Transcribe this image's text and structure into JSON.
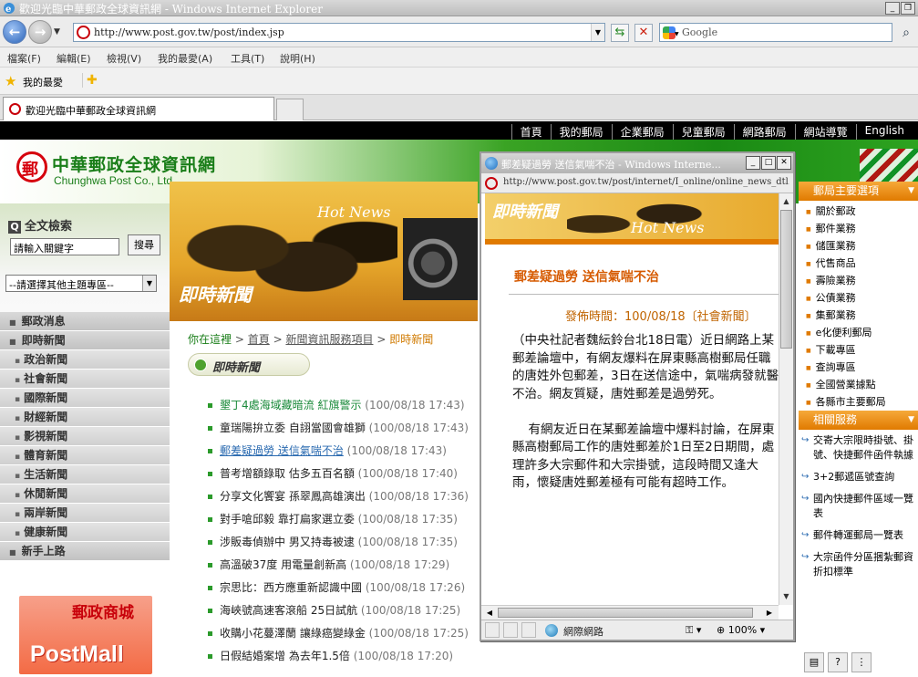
{
  "browser": {
    "window_title": "歡迎光臨中華郵政全球資訊網 - Windows Internet Explorer",
    "url": "http://www.post.gov.tw/post/index.jsp",
    "search_placeholder": "Google",
    "menu": [
      "檔案(F)",
      "編輯(E)",
      "檢視(V)",
      "我的最愛(A)",
      "工具(T)",
      "說明(H)"
    ],
    "favorites_label": "我的最愛",
    "tab_title": "歡迎光臨中華郵政全球資訊網"
  },
  "site": {
    "top_links": [
      "首頁",
      "我的郵局",
      "企業郵局",
      "兒童郵局",
      "網路郵局",
      "網站導覽",
      "English"
    ],
    "brand_cn": "中華郵政全球資訊網",
    "brand_en": "Chunghwa Post Co., Ltd.",
    "search": {
      "title": "全文檢索",
      "keyword_value": "請輸入關鍵字",
      "button": "搜尋",
      "topic_select": "--請選擇其他主題專區--"
    },
    "side_menu": [
      {
        "label": "郵政消息",
        "type": "main"
      },
      {
        "label": "即時新聞",
        "type": "main"
      },
      {
        "label": "政治新聞",
        "type": "sub"
      },
      {
        "label": "社會新聞",
        "type": "sub"
      },
      {
        "label": "國際新聞",
        "type": "sub"
      },
      {
        "label": "財經新聞",
        "type": "sub"
      },
      {
        "label": "影視新聞",
        "type": "sub"
      },
      {
        "label": "體育新聞",
        "type": "sub"
      },
      {
        "label": "生活新聞",
        "type": "sub"
      },
      {
        "label": "休閒新聞",
        "type": "sub"
      },
      {
        "label": "兩岸新聞",
        "type": "sub"
      },
      {
        "label": "健康新聞",
        "type": "sub"
      },
      {
        "label": "新手上路",
        "type": "main"
      }
    ],
    "postmall": {
      "cn": "郵政商城",
      "en": "PostMall"
    },
    "hero": {
      "hot_news": "Hot News",
      "title": "即時新聞"
    },
    "breadcrumb": {
      "here": "你在這裡",
      "sep": ">",
      "home": "首頁",
      "section": "新聞資訊服務項目",
      "current": "即時新聞"
    },
    "section_title": "即時新聞",
    "news": [
      {
        "title": "墾丁4處海域藏暗流 紅旗警示",
        "time": "(100/08/18 17:43)",
        "style": "hl"
      },
      {
        "title": "童瑞陽拚立委 自詡當國會雄獅",
        "time": "(100/08/18 17:43)",
        "style": ""
      },
      {
        "title": "郵差疑過勞 送信氣喘不治",
        "time": "(100/08/18 17:43)",
        "style": "visited"
      },
      {
        "title": "普考增額錄取 估多五百名額",
        "time": "(100/08/18 17:40)",
        "style": ""
      },
      {
        "title": "分享文化饗宴 孫翠鳳高雄演出",
        "time": "(100/08/18 17:36)",
        "style": ""
      },
      {
        "title": "對手嗆邱毅 靠打扁家選立委",
        "time": "(100/08/18 17:35)",
        "style": ""
      },
      {
        "title": "涉販毒偵辦中 男又持毒被逮",
        "time": "(100/08/18 17:35)",
        "style": ""
      },
      {
        "title": "高溫破37度 用電量創新高",
        "time": "(100/08/18 17:29)",
        "style": ""
      },
      {
        "title": "宗思比：西方應重新認識中國",
        "time": "(100/08/18 17:26)",
        "style": ""
      },
      {
        "title": "海峽號高速客滾船 25日試航",
        "time": "(100/08/18 17:25)",
        "style": ""
      },
      {
        "title": "收購小花蔓澤蘭 讓綠癌變綠金",
        "time": "(100/08/18 17:25)",
        "style": ""
      },
      {
        "title": "日假結婚案增 為去年1.5倍",
        "time": "(100/08/18 17:20)",
        "style": ""
      }
    ],
    "right_main_title": "郵局主要選項",
    "right_main_items": [
      "關於郵政",
      "郵件業務",
      "儲匯業務",
      "代售商品",
      "壽險業務",
      "公債業務",
      "集郵業務",
      "e化便利郵局",
      "下載專區",
      "查詢專區",
      "全國營業據點",
      "各縣市主要郵局"
    ],
    "right_services_title": "相關服務",
    "right_services": [
      "交寄大宗限時掛號、掛號、快捷郵件函件執據",
      "3+2郵遞區號查詢",
      "國內快捷郵件區域一覽表",
      "郵件轉運郵局一覽表",
      "大宗函件分區捆紮郵資折扣標準"
    ]
  },
  "popup": {
    "window_title": "郵差疑過勞 送信氣喘不治 - Windows Interne...",
    "url": "http://www.post.gov.tw/post/internet/I_online/online_news_dtl.jsp?",
    "banner_title": "即時新聞",
    "banner_hot": "Hot News",
    "article_title": "郵差疑過勞 送信氣喘不治",
    "article_meta": "發佈時間：100/08/18〔社會新聞〕",
    "paragraphs": [
      "（中央社記者魏紜鈴台北18日電）近日網路上某郵差論壇中，有網友爆料在屏東縣高樹郵局任職的唐姓外包郵差，3日在送信途中，氣喘病發就醫不治。網友質疑，唐姓郵差是過勞死。",
      "有網友近日在某郵差論壇中爆料討論，在屏東縣高樹郵局工作的唐姓郵差於1日至2日期間，處理許多大宗郵件和大宗掛號，這段時間又逢大雨，懷疑唐姓郵差極有可能有超時工作。"
    ],
    "status_zone": "網際網路",
    "zoom": "100%"
  }
}
